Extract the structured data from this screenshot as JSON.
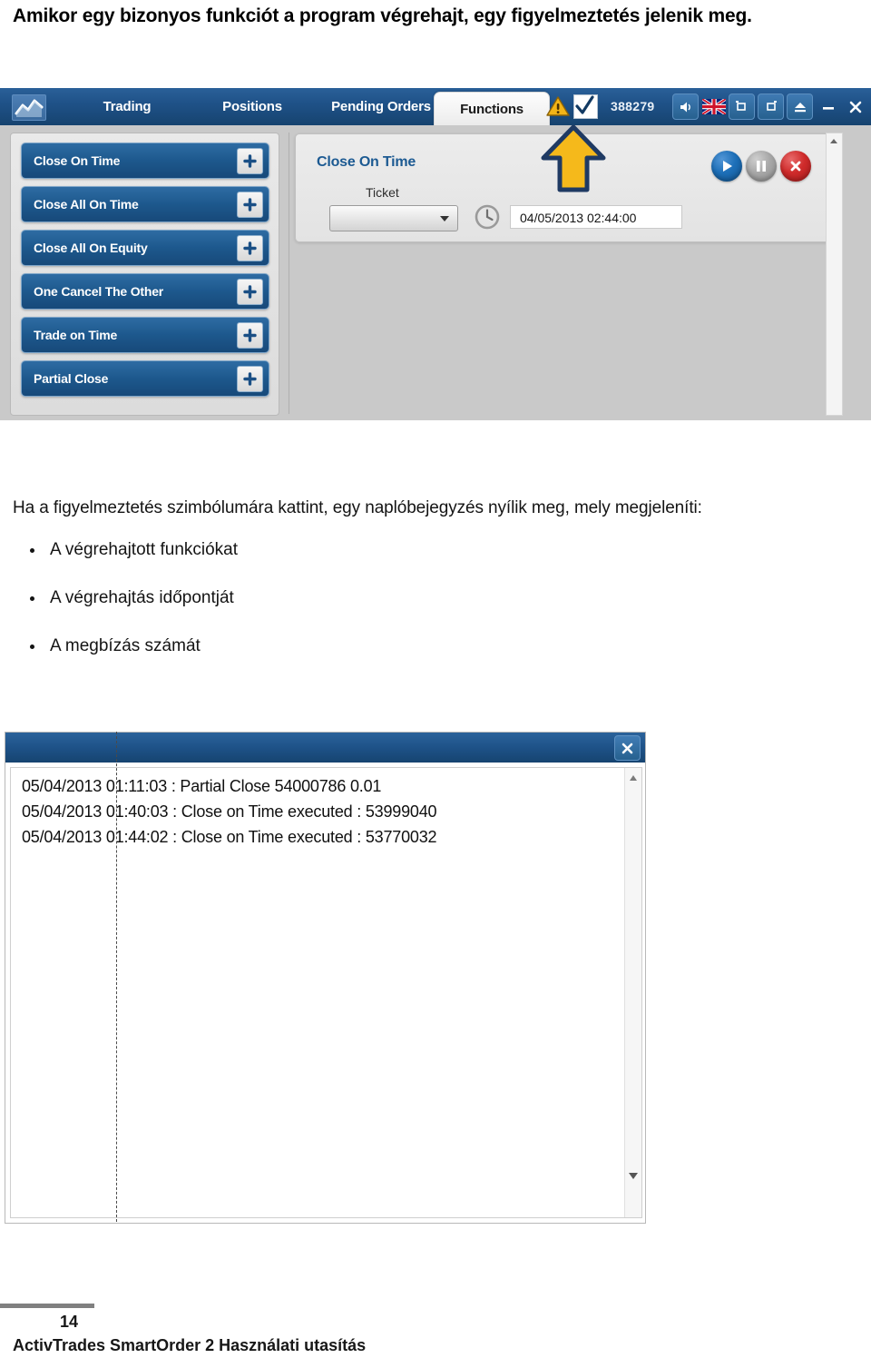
{
  "document": {
    "heading": "Amikor egy bizonyos funkciót a program végrehajt, egy figyelmeztetés jelenik meg.",
    "paragraph": "Ha a figyelmeztetés szimbólumára kattint, egy naplóbejegyzés nyílik meg, mely megjeleníti:",
    "bullets": [
      "A végrehajtott funkciókat",
      "A végrehajtás időpontját",
      "A megbízás számát"
    ]
  },
  "app": {
    "tabs": [
      {
        "label": "Trading",
        "active": false
      },
      {
        "label": "Positions",
        "active": false
      },
      {
        "label": "Pending Orders",
        "active": false
      },
      {
        "label": "Functions",
        "active": true
      }
    ],
    "logo_icon": "chart-line-icon",
    "status": {
      "warning_icon": "warning-triangle-icon",
      "check_icon": "checkmark-icon",
      "account_number": "388279"
    },
    "window_buttons": [
      {
        "name": "sound-icon",
        "glyph": "◀))"
      },
      {
        "name": "uk-flag-icon",
        "glyph": ""
      },
      {
        "name": "dock-left-icon",
        "glyph": ""
      },
      {
        "name": "dock-right-icon",
        "glyph": ""
      },
      {
        "name": "eject-icon",
        "glyph": ""
      },
      {
        "name": "minimize-icon",
        "glyph": "–"
      },
      {
        "name": "close-icon",
        "glyph": "✕"
      }
    ],
    "functions": [
      "Close On Time",
      "Close All On Time",
      "Close All On Equity",
      "One Cancel The Other",
      "Trade on Time",
      "Partial Close"
    ],
    "panel": {
      "title": "Close On Time",
      "ticket_label": "Ticket",
      "ticket_value": "",
      "clock_icon": "clock-icon",
      "datetime_value": "04/05/2013 02:44:00",
      "controls": [
        {
          "name": "start-button",
          "icon": "play-icon"
        },
        {
          "name": "pause-button",
          "icon": "pause-icon"
        },
        {
          "name": "stop-button",
          "icon": "close-x-icon"
        }
      ]
    },
    "callout": {
      "icon": "yellow-up-arrow-annotation"
    }
  },
  "log_window": {
    "close_icon": "close-icon",
    "entries": [
      "05/04/2013 01:11:03 : Partial Close 54000786 0.01",
      "05/04/2013 01:40:03 : Close on Time executed : 53999040",
      "05/04/2013 01:44:02 : Close on Time executed : 53770032"
    ],
    "scroll_up_icon": "scroll-up-arrow-icon",
    "scroll_down_icon": "scroll-down-arrow-icon"
  },
  "footer": {
    "page_number": "14",
    "title": "ActivTrades SmartOrder 2 Használati utasítás"
  },
  "colors": {
    "title_bar_blue": "#1f5288",
    "button_blue": "#1d588d",
    "panel_title_blue": "#1c5a92",
    "callout_yellow": "#f5b91b",
    "callout_outline": "#1f3a63",
    "stop_red": "#cf2b2b"
  }
}
